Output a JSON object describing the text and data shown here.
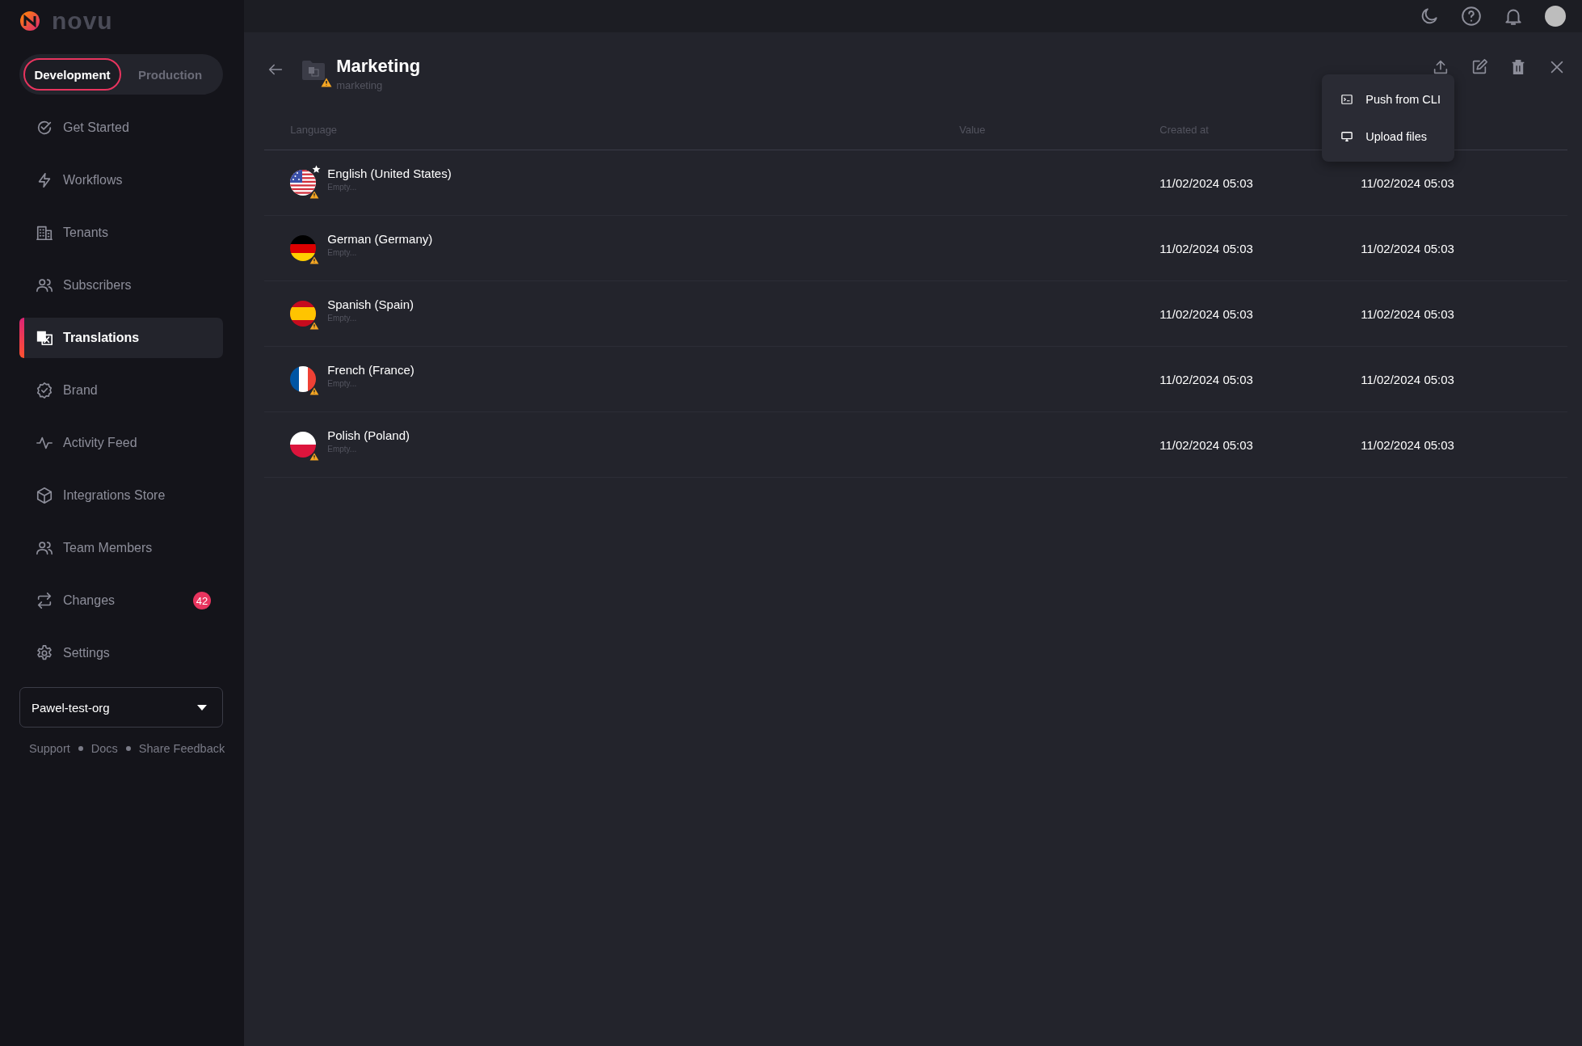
{
  "app": {
    "logo": "novu"
  },
  "environment": {
    "options": [
      {
        "label": "Development",
        "selected": true
      },
      {
        "label": "Production",
        "selected": false
      }
    ]
  },
  "sidebar": {
    "items": [
      {
        "label": "Get Started",
        "selected": false
      },
      {
        "label": "Workflows",
        "selected": false
      },
      {
        "label": "Tenants",
        "selected": false
      },
      {
        "label": "Subscribers",
        "selected": false
      },
      {
        "label": "Translations",
        "selected": true
      },
      {
        "label": "Brand",
        "selected": false
      },
      {
        "label": "Activity Feed",
        "selected": false
      },
      {
        "label": "Integrations Store",
        "selected": false
      },
      {
        "label": "Team Members",
        "selected": false
      },
      {
        "label": "Changes",
        "selected": false,
        "badge": "42"
      },
      {
        "label": "Settings",
        "selected": false
      }
    ]
  },
  "organization": {
    "value": "Pawel-test-org"
  },
  "footer_links": [
    "Support",
    "Docs",
    "Share Feedback"
  ],
  "page": {
    "title": "Marketing",
    "subtitle": "marketing",
    "warning": true
  },
  "upload_menu": {
    "items": [
      "Push from CLI",
      "Upload files"
    ]
  },
  "table": {
    "columns": [
      "Language",
      "Value",
      "Created at"
    ],
    "rows": [
      {
        "kind": "us",
        "language": "English (United States)",
        "subtitle": "Empty...",
        "default": true,
        "warning": true,
        "created_at": "11/02/2024 05:03",
        "column_4": "11/02/2024 05:03"
      },
      {
        "kind": "de",
        "language": "German (Germany)",
        "subtitle": "Empty...",
        "default": false,
        "warning": true,
        "created_at": "11/02/2024 05:03",
        "column_4": "11/02/2024 05:03"
      },
      {
        "kind": "es",
        "language": "Spanish (Spain)",
        "subtitle": "Empty...",
        "default": false,
        "warning": true,
        "created_at": "11/02/2024 05:03",
        "column_4": "11/02/2024 05:03"
      },
      {
        "kind": "fr",
        "language": "French (France)",
        "subtitle": "Empty...",
        "default": false,
        "warning": true,
        "created_at": "11/02/2024 05:03",
        "column_4": "11/02/2024 05:03"
      },
      {
        "kind": "pl",
        "language": "Polish (Poland)",
        "subtitle": "Empty...",
        "default": false,
        "warning": true,
        "created_at": "11/02/2024 05:03",
        "column_4": "11/02/2024 05:03"
      }
    ]
  }
}
